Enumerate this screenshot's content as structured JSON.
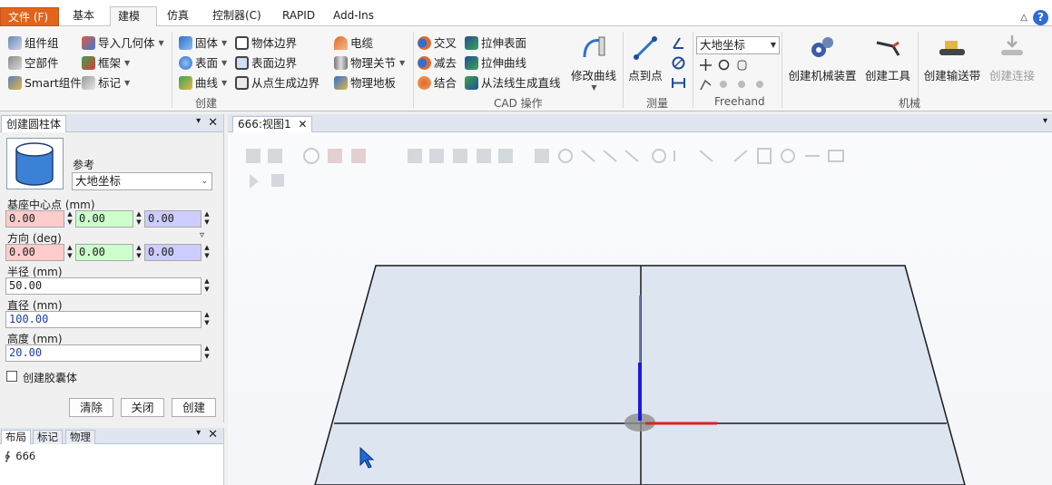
{
  "tabs": [
    {
      "label": "文件 (F)",
      "type": "file"
    },
    {
      "label": "基本"
    },
    {
      "label": "建模",
      "active": true
    },
    {
      "label": "仿真"
    },
    {
      "label": "控制器(C)"
    },
    {
      "label": "RAPID"
    },
    {
      "label": "Add-Ins"
    }
  ],
  "ribbon": {
    "create": {
      "component_group": "组件组",
      "empty_part": "空部件",
      "smart_component": "Smart组件",
      "import_geometry": "导入几何体",
      "frame": "框架",
      "tag": "标记",
      "label": "创建"
    },
    "cad": {
      "solid": "固体",
      "surface": "表面",
      "curve": "曲线",
      "object_border": "物体边界",
      "surface_border": "表面边界",
      "border_from_points": "从点生成边界",
      "cable": "电缆",
      "physics_joint": "物理关节",
      "physics_floor": "物理地板",
      "intersect": "交叉",
      "subtract": "减去",
      "union": "结合",
      "extrude_surface": "拉伸表面",
      "extrude_curve": "拉伸曲线",
      "line_from_normal": "从法线生成直线",
      "modify_curve": "修改曲线",
      "label": "CAD 操作"
    },
    "measure": {
      "point_to_point": "点到点",
      "label": "测量"
    },
    "freehand": {
      "frame_combo": "大地坐标",
      "label": "Freehand"
    },
    "mechanism": {
      "create_mechanism": "创建机械装置",
      "create_tool": "创建工具",
      "create_conveyor": "创建输送带",
      "create_connection": "创建连接",
      "label": "机械"
    }
  },
  "panel": {
    "title": "创建圆柱体",
    "reference_label": "参考",
    "reference_value": "大地坐标",
    "base_center_label": "基座中心点 (mm)",
    "base_center": [
      "0.00",
      "0.00",
      "0.00"
    ],
    "orientation_label": "方向 (deg)",
    "orientation": [
      "0.00",
      "0.00",
      "0.00"
    ],
    "radius_label": "半径 (mm)",
    "radius": "50.00",
    "diameter_label": "直径 (mm)",
    "diameter": "100.00",
    "height_label": "高度 (mm)",
    "height": "20.00",
    "capsule_label": "创建胶囊体",
    "clear_button": "清除",
    "close_button": "关闭",
    "create_button": "创建"
  },
  "layout_panel": {
    "tabs": [
      "布局",
      "标记",
      "物理"
    ],
    "station_item": "666"
  },
  "viewport": {
    "tab_label": "666:视图1"
  },
  "colors": {
    "file_tab": "#e0641c",
    "axis_x": "#e02020",
    "axis_z": "#1a1ae0",
    "help_blue": "#2d6bd6"
  }
}
